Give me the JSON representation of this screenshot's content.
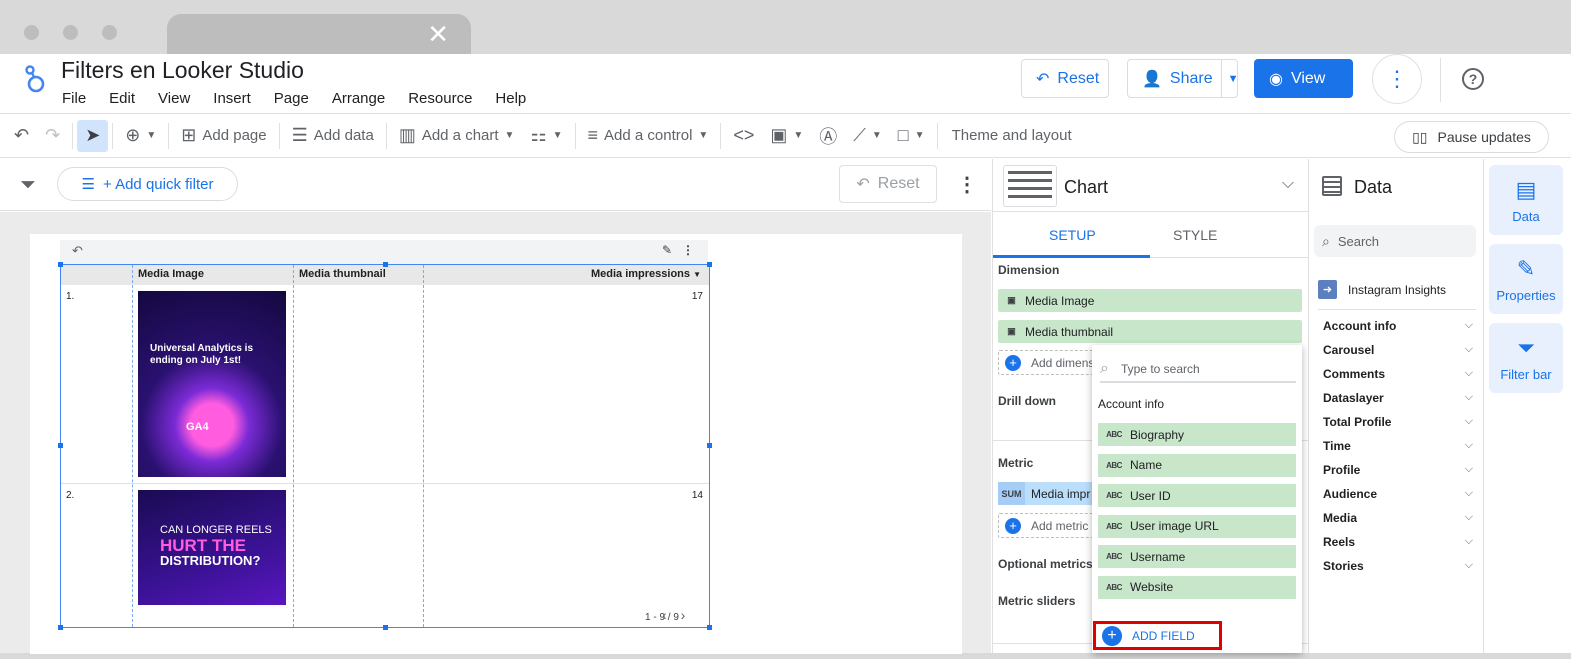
{
  "document": {
    "title": "Filters en Looker Studio"
  },
  "menu": [
    "File",
    "Edit",
    "View",
    "Insert",
    "Page",
    "Arrange",
    "Resource",
    "Help"
  ],
  "header_buttons": {
    "reset": "Reset",
    "share": "Share",
    "view": "View"
  },
  "toolbar": {
    "add_page": "Add page",
    "add_data": "Add data",
    "add_chart": "Add a chart",
    "add_control": "Add a control",
    "theme": "Theme and layout",
    "pause": "Pause updates"
  },
  "filterbar": {
    "quick_filter": "+ Add quick filter",
    "reset": "Reset"
  },
  "table": {
    "columns": [
      "Media Image",
      "Media thumbnail",
      "Media impressions"
    ],
    "rows": [
      {
        "num": "1.",
        "impressions": "17",
        "image_lines": [
          "Universal Analytics is",
          "ending on July 1st!",
          "GA4"
        ]
      },
      {
        "num": "2.",
        "impressions": "14",
        "image_lines": [
          "CAN LONGER REELS",
          "HURT THE",
          "DISTRIBUTION?"
        ]
      }
    ],
    "pager": "1 - 9 / 9"
  },
  "chart_panel": {
    "title": "Chart",
    "tabs": [
      "SETUP",
      "STYLE"
    ],
    "dimension_label": "Dimension",
    "dimensions": [
      "Media Image",
      "Media thumbnail"
    ],
    "add_dimension": "Add dimens",
    "drill_down": "Drill down",
    "metric_label": "Metric",
    "metric_badge": "SUM",
    "metric": "Media impr",
    "add_metric": "Add metric",
    "optional_metrics": "Optional metrics",
    "metric_sliders": "Metric sliders"
  },
  "field_picker": {
    "placeholder": "Type to search",
    "group": "Account info",
    "type_badge": "ABC",
    "fields": [
      "Biography",
      "Name",
      "User ID",
      "User image URL",
      "Username",
      "Website"
    ],
    "add_field": "ADD FIELD"
  },
  "data_panel": {
    "title": "Data",
    "search_placeholder": "Search",
    "source": "Instagram Insights",
    "groups": [
      "Account info",
      "Carousel",
      "Comments",
      "Dataslayer",
      "Total Profile",
      "Time",
      "Profile",
      "Audience",
      "Media",
      "Reels",
      "Stories"
    ]
  },
  "rail": {
    "data": "Data",
    "properties": "Properties",
    "filter_bar": "Filter bar"
  }
}
